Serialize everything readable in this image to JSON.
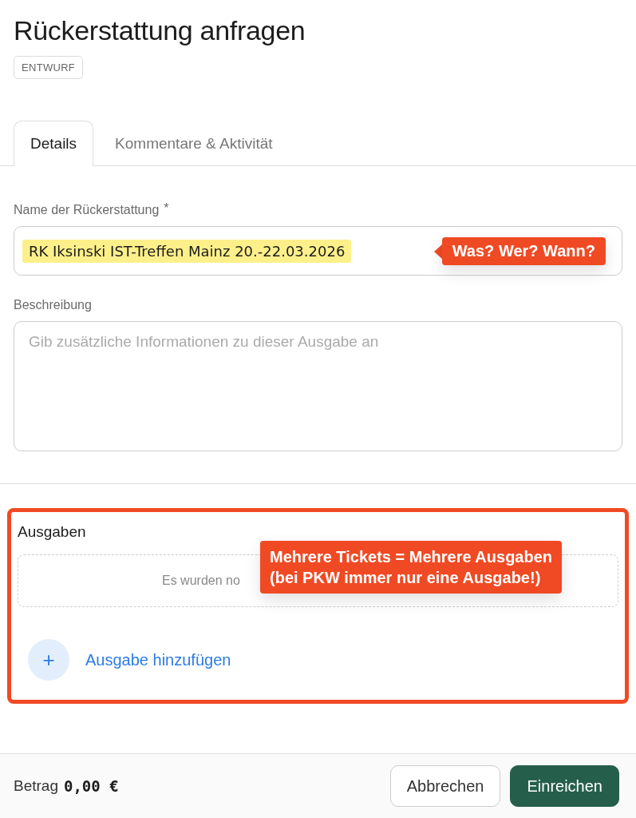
{
  "page": {
    "title": "Rückerstattung anfragen",
    "status_badge": "ENTWURF"
  },
  "tabs": [
    {
      "label": "Details",
      "selected": true
    },
    {
      "label": "Kommentare & Aktivität",
      "selected": false
    }
  ],
  "name_field": {
    "label": "Name der Rückerstattung",
    "required_mark": "*",
    "value": "RK Iksinski IST-Treffen Mainz 20.-22.03.2026",
    "highlighted": true,
    "callout": "Was? Wer? Wann?"
  },
  "description_field": {
    "label": "Beschreibung",
    "placeholder": "Gib zusätzliche Informationen zu dieser Ausgabe an"
  },
  "expenses": {
    "heading": "Ausgaben",
    "framed": true,
    "empty_text": "Es wurden no",
    "callout_lines": [
      "Mehrere Tickets = Mehrere Ausgaben",
      "(bei PKW immer nur eine Ausgabe!)"
    ],
    "add_icon": "+",
    "add_label": "Ausgabe hinzufügen"
  },
  "footer": {
    "amount_label": "Betrag",
    "amount": "0,00 €",
    "buttons": [
      {
        "label": "Abbrechen",
        "kind": "secondary"
      },
      {
        "label": "Einreichen",
        "kind": "primary"
      }
    ]
  }
}
